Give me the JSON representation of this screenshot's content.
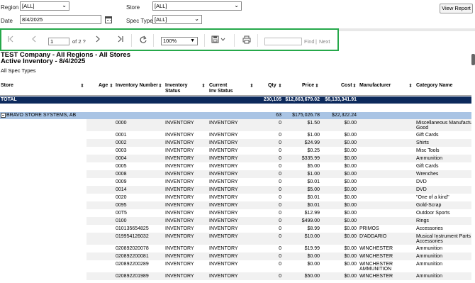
{
  "params": {
    "region_label": "Region",
    "region_value": "[ALL]",
    "store_label": "Store",
    "store_value": "[ALL]",
    "date_label": "Date",
    "date_value": "8/4/2025",
    "spec_type_label": "Spec Type",
    "spec_type_value": "[ALL]",
    "view_report_label": "View Report"
  },
  "toolbar": {
    "page_value": "1",
    "page_of": "of 2 ?",
    "zoom_value": "100%",
    "find_label": "Find",
    "separator": "|",
    "next_label": "Next",
    "icons": [
      "first-page-icon",
      "prev-page-icon",
      "next-page-icon",
      "last-page-icon",
      "refresh-icon",
      "save-icon",
      "print-icon"
    ]
  },
  "report": {
    "title": "TEST Company - All Regions - All Stores",
    "subtitle": "Active Inventory - 8/4/2025",
    "spec_types": "All Spec Types",
    "columns": {
      "store": "Store",
      "age": "Age",
      "inventory_number": "Inventory Number",
      "inventory_status_1": "Inventory",
      "inventory_status_2": "Status",
      "current_status_1": "Current",
      "current_status_2": "Inv Status",
      "qty": "Qty",
      "price": "Price",
      "cost": "Cost",
      "manufacturer": "Manufacturer",
      "category": "Category Name"
    },
    "total": {
      "label": "TOTAL",
      "qty": "230,105",
      "price": "$12,863,679.02",
      "cost": "$6,133,341.91"
    },
    "group": {
      "store": "BRAVO STORE SYSTEMS, AB",
      "qty": "63",
      "price": "$175,026.78",
      "cost": "$22,322.24"
    },
    "rows": [
      {
        "num": "0000",
        "status": "INVENTORY",
        "cur": "INVENTORY",
        "qty": "0",
        "price": "$1.50",
        "cost": "$0.00",
        "mfr": "",
        "cat1": "Miscellaneous Manufacture",
        "cat2": "Good"
      },
      {
        "num": "0001",
        "status": "INVENTORY",
        "cur": "INVENTORY",
        "qty": "0",
        "price": "$1.00",
        "cost": "$0.00",
        "mfr": "",
        "cat1": "Gift Cards",
        "cat2": ""
      },
      {
        "num": "0002",
        "status": "INVENTORY",
        "cur": "INVENTORY",
        "qty": "0",
        "price": "$24.99",
        "cost": "$0.00",
        "mfr": "",
        "cat1": "Shirts",
        "cat2": ""
      },
      {
        "num": "0003",
        "status": "INVENTORY",
        "cur": "INVENTORY",
        "qty": "0",
        "price": "$0.25",
        "cost": "$0.00",
        "mfr": "",
        "cat1": "Misc Tools",
        "cat2": ""
      },
      {
        "num": "0004",
        "status": "INVENTORY",
        "cur": "INVENTORY",
        "qty": "0",
        "price": "$335.99",
        "cost": "$0.00",
        "mfr": "",
        "cat1": "Ammunition",
        "cat2": ""
      },
      {
        "num": "0005",
        "status": "INVENTORY",
        "cur": "INVENTORY",
        "qty": "0",
        "price": "$5.00",
        "cost": "$0.00",
        "mfr": "",
        "cat1": "Gift Cards",
        "cat2": ""
      },
      {
        "num": "0008",
        "status": "INVENTORY",
        "cur": "INVENTORY",
        "qty": "0",
        "price": "$1.00",
        "cost": "$0.00",
        "mfr": "",
        "cat1": "Wrenches",
        "cat2": ""
      },
      {
        "num": "0009",
        "status": "INVENTORY",
        "cur": "INVENTORY",
        "qty": "0",
        "price": "$0.01",
        "cost": "$0.00",
        "mfr": "",
        "cat1": "DVD",
        "cat2": ""
      },
      {
        "num": "0014",
        "status": "INVENTORY",
        "cur": "INVENTORY",
        "qty": "0",
        "price": "$5.00",
        "cost": "$0.00",
        "mfr": "",
        "cat1": "DVD",
        "cat2": ""
      },
      {
        "num": "0020",
        "status": "INVENTORY",
        "cur": "INVENTORY",
        "qty": "0",
        "price": "$0.01",
        "cost": "$0.00",
        "mfr": "",
        "cat1": "\"One of a kind\"",
        "cat2": ""
      },
      {
        "num": "0095",
        "status": "INVENTORY",
        "cur": "INVENTORY",
        "qty": "0",
        "price": "$0.01",
        "cost": "$0.00",
        "mfr": "",
        "cat1": "Gold-Scrap",
        "cat2": ""
      },
      {
        "num": "00T5",
        "status": "INVENTORY",
        "cur": "INVENTORY",
        "qty": "0",
        "price": "$12.99",
        "cost": "$0.00",
        "mfr": "",
        "cat1": "Outdoor Sports",
        "cat2": ""
      },
      {
        "num": "0100",
        "status": "INVENTORY",
        "cur": "INVENTORY",
        "qty": "0",
        "price": "$499.00",
        "cost": "$0.00",
        "mfr": "",
        "cat1": "Rings",
        "cat2": ""
      },
      {
        "num": "010135654825",
        "status": "INVENTORY",
        "cur": "INVENTORY",
        "qty": "0",
        "price": "$8.99",
        "cost": "$0.00",
        "mfr": "PRIMOS",
        "cat1": "Accessories",
        "cat2": ""
      },
      {
        "num": "019954126032",
        "status": "INVENTORY",
        "cur": "INVENTORY",
        "qty": "0",
        "price": "$10.00",
        "cost": "$0.00",
        "mfr": "D'ADDARIO",
        "cat1": "Musical Instrument Parts &",
        "cat2": "Accessories"
      },
      {
        "num": "020892020078",
        "status": "INVENTORY",
        "cur": "INVENTORY",
        "qty": "0",
        "price": "$19.99",
        "cost": "$0.00",
        "mfr": "WINCHESTER",
        "cat1": "Ammunition",
        "cat2": ""
      },
      {
        "num": "020892200081",
        "status": "INVENTORY",
        "cur": "INVENTORY",
        "qty": "0",
        "price": "$0.00",
        "cost": "$0.00",
        "mfr": "WINCHESTER",
        "cat1": "Ammunition",
        "cat2": ""
      },
      {
        "num": "020892200289",
        "status": "INVENTORY",
        "cur": "INVENTORY",
        "qty": "0",
        "price": "$0.00",
        "cost": "$0.00",
        "mfr": "WINCHESTER",
        "mfr2": "AMMUNITION",
        "cat1": "Ammunition",
        "cat2": ""
      },
      {
        "num": "020892201989",
        "status": "INVENTORY",
        "cur": "INVENTORY",
        "qty": "0",
        "price": "$50.00",
        "cost": "$0.00",
        "mfr": "WINCHESTER",
        "cat1": "Ammunition",
        "cat2": ""
      }
    ]
  },
  "colors": {
    "toolbar_border": "#25a84a",
    "total_bg": "#0d2a5c",
    "group_bg": "#a9c4e4",
    "alt_row_bg": "#f1f1f1"
  }
}
